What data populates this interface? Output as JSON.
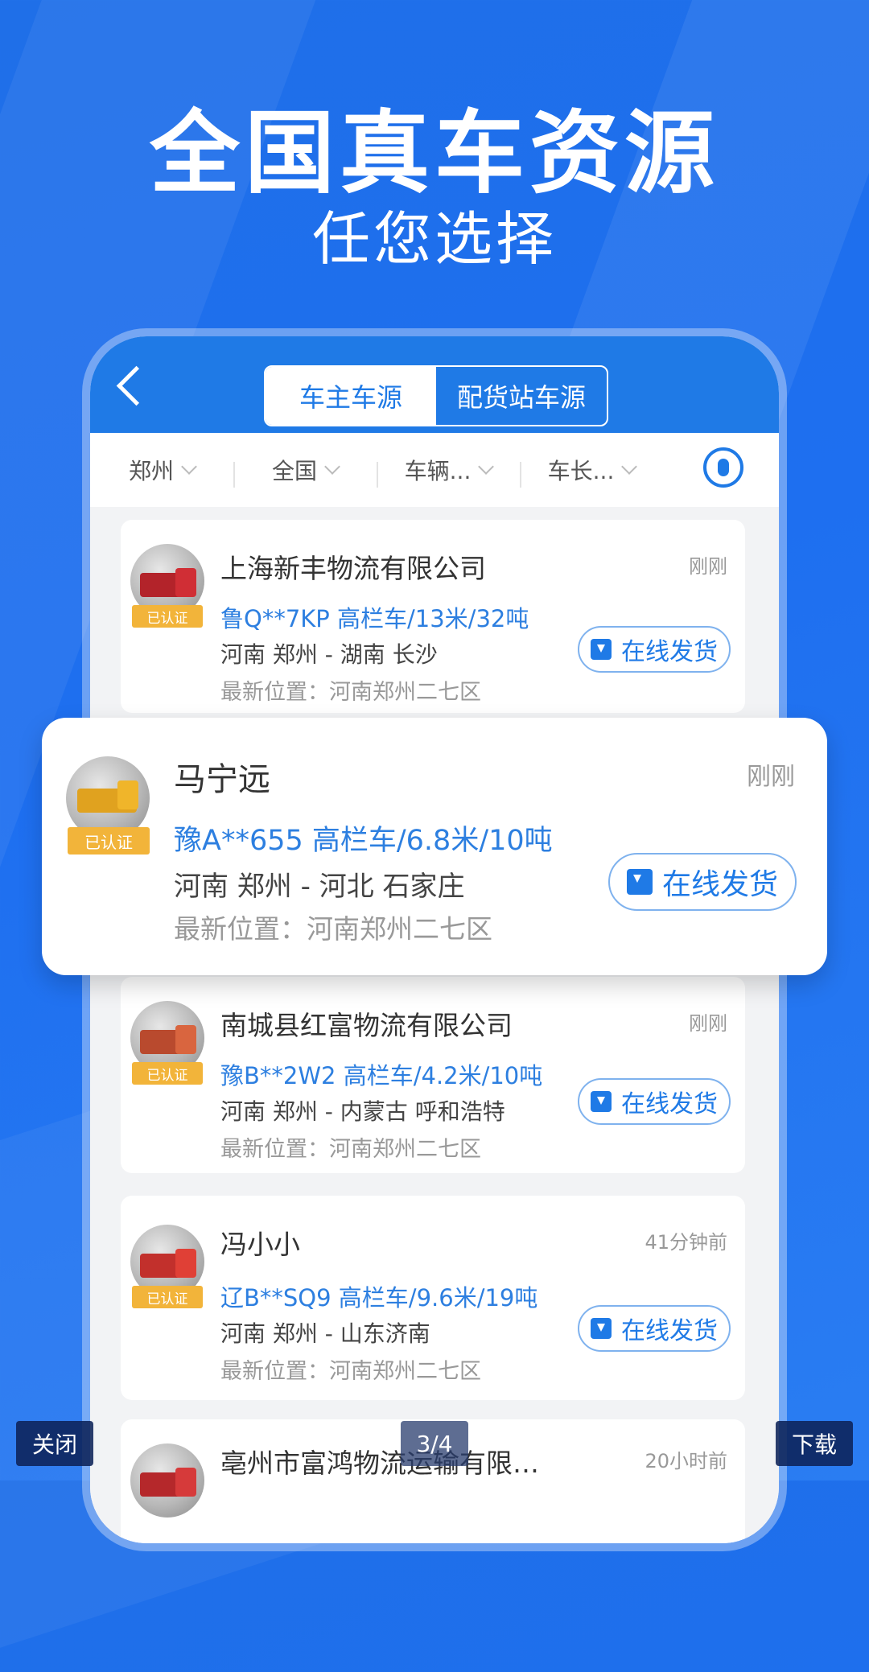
{
  "hero": {
    "title": "全国真车资源",
    "subtitle": "任您选择"
  },
  "phone": {
    "tabs": [
      {
        "label": "车主车源",
        "active": true
      },
      {
        "label": "配货站车源",
        "active": false
      }
    ],
    "filters": [
      "郑州",
      "全国",
      "车辆...",
      "车长..."
    ],
    "mic_icon": "microphone-icon"
  },
  "cards": [
    {
      "name": "上海新丰物流有限公司",
      "time": "刚刚",
      "plate": "鲁Q**7KP 高栏车/13米/32吨",
      "route": "河南 郑州 - 湖南 长沙",
      "position": "最新位置：河南郑州二七区",
      "badge": "已认证",
      "button": "在线发货"
    },
    {
      "name": "马宁远",
      "time": "刚刚",
      "plate": "豫A**655 高栏车/6.8米/10吨",
      "route": "河南 郑州 - 河北 石家庄",
      "position": "最新位置：河南郑州二七区",
      "badge": "已认证",
      "button": "在线发货"
    },
    {
      "name": "南城县红富物流有限公司",
      "time": "刚刚",
      "plate": "豫B**2W2 高栏车/4.2米/10吨",
      "route": "河南 郑州 - 内蒙古 呼和浩特",
      "position": "最新位置：河南郑州二七区",
      "badge": "已认证",
      "button": "在线发货"
    },
    {
      "name": "冯小小",
      "time": "41分钟前",
      "plate": "辽B**SQ9 高栏车/9.6米/19吨",
      "route": "河南 郑州 - 山东济南",
      "position": "最新位置：河南郑州二七区",
      "badge": "已认证",
      "button": "在线发货"
    },
    {
      "name": "亳州市富鸿物流运输有限…",
      "time": "20小时前"
    }
  ],
  "overlay": {
    "close": "关闭",
    "page": "3/4",
    "download": "下载"
  },
  "colors": {
    "brand_blue": "#1f7ae6",
    "plate_blue": "#2d7fe0",
    "badge_gold": "#f2b43a"
  }
}
